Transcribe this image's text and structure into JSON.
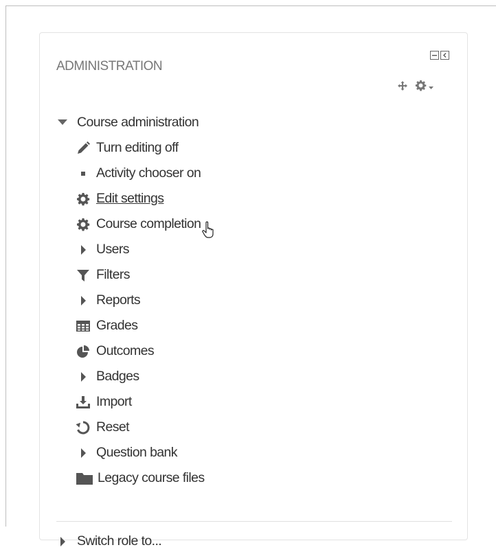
{
  "block": {
    "title": "ADMINISTRATION"
  },
  "tree": {
    "root_label": "Course administration",
    "items": [
      {
        "label": "Turn editing off",
        "icon": "pencil-icon"
      },
      {
        "label": "Activity chooser on",
        "icon": "square-bullet-icon"
      },
      {
        "label": "Edit settings",
        "icon": "gear-icon"
      },
      {
        "label": "Course completion",
        "icon": "gear-icon"
      },
      {
        "label": "Users",
        "icon": "caret-right-icon"
      },
      {
        "label": "Filters",
        "icon": "filter-icon"
      },
      {
        "label": "Reports",
        "icon": "caret-right-icon"
      },
      {
        "label": "Grades",
        "icon": "table-icon"
      },
      {
        "label": "Outcomes",
        "icon": "pie-chart-icon"
      },
      {
        "label": "Badges",
        "icon": "caret-right-icon"
      },
      {
        "label": "Import",
        "icon": "download-icon"
      },
      {
        "label": "Reset",
        "icon": "reset-icon"
      },
      {
        "label": "Question bank",
        "icon": "caret-right-icon"
      },
      {
        "label": "Legacy course files",
        "icon": "folder-icon"
      }
    ],
    "switch_role": "Switch role to..."
  },
  "colors": {
    "text": "#333333",
    "title": "#777777",
    "icon": "#555555",
    "border": "#e3e3e3"
  }
}
